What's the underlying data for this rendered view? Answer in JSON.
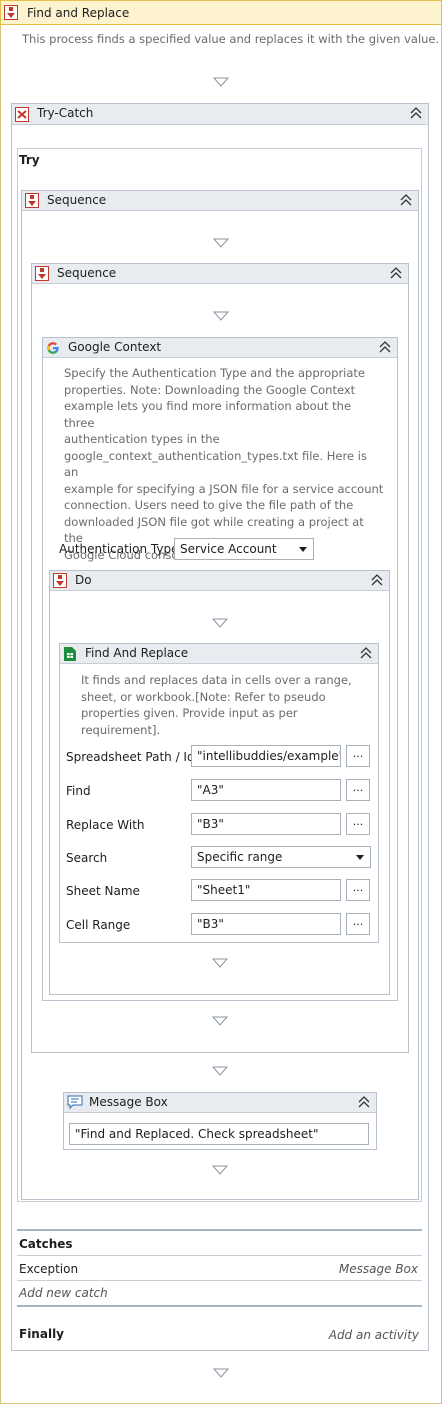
{
  "root": {
    "title": "Find and Replace",
    "description": "This process finds a specified value and replaces it with the given value."
  },
  "try_catch": {
    "title": "Try-Catch",
    "try_label": "Try",
    "catches_label": "Catches",
    "exception_label": "Exception",
    "exception_handler": "Message Box",
    "add_catch": "Add new catch",
    "finally_label": "Finally",
    "add_activity": "Add an activity"
  },
  "sequence_outer": {
    "title": "Sequence"
  },
  "sequence_inner": {
    "title": "Sequence"
  },
  "google_context": {
    "title": "Google Context",
    "description_lines": [
      "Specify the Authentication Type and the appropriate",
      "properties. Note: Downloading the Google Context",
      "example lets you find more information about the three",
      "authentication types in the",
      "google_context_authentication_types.txt file. Here is an",
      "example for specifying a JSON file for a service account",
      "connection. Users need to give the file path of the",
      "downloaded JSON file got while creating a project at the",
      "Google Cloud console."
    ],
    "auth_label": "Authentication Type",
    "auth_value": "Service Account"
  },
  "do": {
    "title": "Do"
  },
  "find_and_replace": {
    "title": "Find And Replace",
    "description_lines": [
      "It finds and replaces data in cells over a range,",
      "sheet, or workbook.[Note: Refer to pseudo",
      "properties given. Provide input as per requirement]."
    ],
    "fields": {
      "spreadsheet_label": "Spreadsheet Path / Id",
      "spreadsheet_value": "\"intellibuddies/example\"",
      "find_label": "Find",
      "find_value": "\"A3\"",
      "replace_label": "Replace With",
      "replace_value": "\"B3\"",
      "search_label": "Search",
      "search_value": "Specific range",
      "sheet_label": "Sheet Name",
      "sheet_value": "\"Sheet1\"",
      "range_label": "Cell Range",
      "range_value": "\"B3\""
    },
    "ellipsis": "..."
  },
  "message_box": {
    "title": "Message Box",
    "value": "\"Find and Replaced. Check spreadsheet\""
  },
  "colors": {
    "header_bg": "#e8ebef",
    "root_header_bg": "#fdf3cf",
    "root_header_border": "#e4c04a",
    "border": "#b9c1cc",
    "sequence_icon_red": "#c0392b",
    "sheets_green": "#1e8e3e"
  }
}
